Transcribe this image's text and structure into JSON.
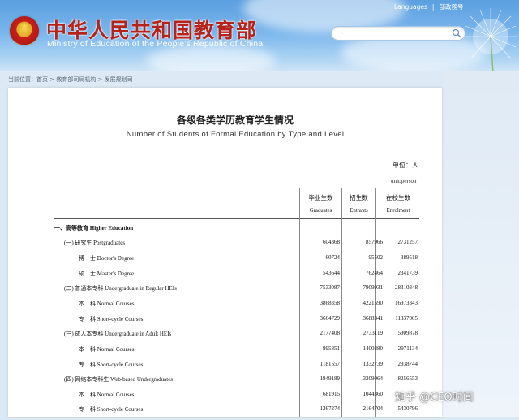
{
  "header": {
    "title": "中华人民共和国教育部",
    "subtitle": "Ministry of Education of the People's Republic of China",
    "links": [
      "Languages",
      "部政務号"
    ]
  },
  "breadcrumb": {
    "text": "当前位置：首页 > 教育部司局机构 > 发展规划司"
  },
  "page": {
    "title_zh": "各级各类学历教育学生情况",
    "title_en": "Number of Students of Formal Education by Type and Level",
    "unit_zh": "单位：人",
    "unit_en": "unit:person"
  },
  "table": {
    "columns": [
      {
        "zh": "毕业生数",
        "en": "Graduates"
      },
      {
        "zh": "招生数",
        "en": "Entrants"
      },
      {
        "zh": "在校生数",
        "en": "Enrolment"
      }
    ],
    "rows": [
      {
        "label": "一、高等教育 Higher Education",
        "values": [
          "",
          "",
          ""
        ]
      },
      {
        "label": "(一) 研究生 Postgraduates",
        "values": [
          "604368",
          "857966",
          "2731257"
        ]
      },
      {
        "label": "博　士 Doctor's Degree",
        "values": [
          "60724",
          "95502",
          "389518"
        ]
      },
      {
        "label": "硕　士 Master's Degree",
        "values": [
          "543644",
          "762464",
          "2341739"
        ]
      },
      {
        "label": "(二) 普通本专科 Undergraduate in Regular HEIs",
        "values": [
          "7533087",
          "7909931",
          "28310348"
        ]
      },
      {
        "label": "本　科 Normal Courses",
        "values": [
          "3868358",
          "4221590",
          "16973343"
        ]
      },
      {
        "label": "专　科 Short-cycle Courses",
        "values": [
          "3664729",
          "3688341",
          "11337005"
        ]
      },
      {
        "label": "(三) 成人本专科 Undergraduate in Adult HEIs",
        "values": [
          "2177408",
          "2733119",
          "5909878"
        ]
      },
      {
        "label": "本　科 Normal Courses",
        "values": [
          "995851",
          "1400380",
          "2971134"
        ]
      },
      {
        "label": "专　科 Short-cycle Courses",
        "values": [
          "1181557",
          "1332739",
          "2938744"
        ]
      },
      {
        "label": "(四) 网络本专科生 Web-based Undergraduates",
        "values": [
          "1949189",
          "3209064",
          "8256553"
        ]
      },
      {
        "label": "本　科 Normal Courses",
        "values": [
          "681915",
          "1044360",
          ""
        ]
      },
      {
        "label": "专　科 Short-cycle Courses",
        "values": [
          "1267274",
          "2164704",
          "5430796"
        ]
      }
    ]
  },
  "watermark": "知乎 @CEO时间"
}
